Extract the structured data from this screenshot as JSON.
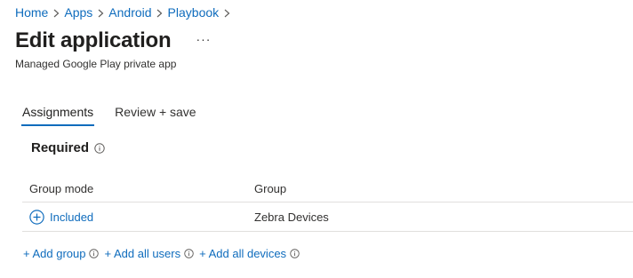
{
  "breadcrumb": [
    "Home",
    "Apps",
    "Android",
    "Playbook"
  ],
  "header": {
    "title": "Edit application",
    "more": "···",
    "subtitle": "Managed Google Play private app"
  },
  "tabs": [
    {
      "label": "Assignments",
      "active": true
    },
    {
      "label": "Review + save",
      "active": false
    }
  ],
  "section": {
    "title": "Required"
  },
  "table": {
    "columns": [
      "Group mode",
      "Group"
    ],
    "rows": [
      {
        "mode": "Included",
        "group": "Zebra Devices"
      }
    ]
  },
  "actions": {
    "add_group": "+ Add group",
    "add_all_users": "+ Add all users",
    "add_all_devices": "+ Add all devices"
  },
  "colors": {
    "accent": "#0f6cbd",
    "text": "#323130",
    "divider": "#e1dfdd"
  },
  "icons": [
    "chevron-right-icon",
    "more-icon",
    "info-icon",
    "plus-circle-icon"
  ]
}
